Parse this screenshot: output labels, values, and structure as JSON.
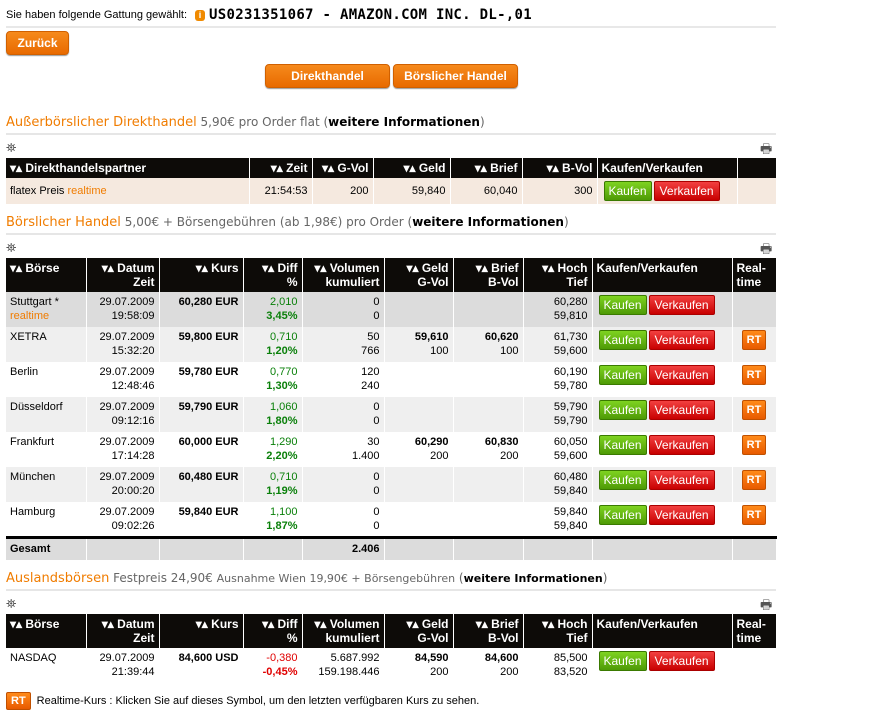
{
  "header": {
    "label": "Sie haben folgende Gattung gewählt:",
    "instrument": "US0231351067 - AMAZON.COM INC. DL-,01"
  },
  "buttons": {
    "back": "Zurück",
    "direct": "Direkthandel",
    "exchange": "Börslicher Handel",
    "buy": "Kaufen",
    "sell": "Verkaufen",
    "rt": "RT"
  },
  "direct": {
    "title": "Außerbörslicher Direkthandel",
    "fee": "5,90€ pro Order flat",
    "more": "weitere Informationen",
    "columns": [
      "Direkthandelspartner",
      "Zeit",
      "G-Vol",
      "Geld",
      "Brief",
      "B-Vol",
      "Kaufen/Verkaufen",
      ""
    ],
    "row": {
      "partner": "flatex Preis",
      "realtime": "realtime",
      "time": "21:54:53",
      "gvol": "200",
      "bid": "59,840",
      "ask": "60,040",
      "bvol": "300"
    }
  },
  "exchange": {
    "title": "Börslicher Handel",
    "fee": "5,00€ + Börsengebühren (ab 1,98€) pro Order",
    "more": "weitere Informationen",
    "columns": [
      [
        "Börse",
        ""
      ],
      [
        "Datum",
        "Zeit"
      ],
      [
        "Kurs",
        ""
      ],
      [
        "Diff",
        "%"
      ],
      [
        "Volumen",
        "kumuliert"
      ],
      [
        "Geld",
        "G-Vol"
      ],
      [
        "Brief",
        "B-Vol"
      ],
      [
        "Hoch",
        "Tief"
      ],
      [
        "Kaufen/Verkaufen",
        ""
      ],
      [
        "Real-",
        "time"
      ]
    ],
    "rows": [
      {
        "name": "Stuttgart *",
        "sub": "realtime",
        "date": "29.07.2009",
        "time": "19:58:09",
        "price": "60,280 EUR",
        "diff": "2,010",
        "pct": "3,45%",
        "vol": "0",
        "volcum": "0",
        "bid": "",
        "gvol": "",
        "ask": "",
        "bvol": "",
        "high": "60,280",
        "low": "59,810",
        "rt": false,
        "bg": "#dcdcdc"
      },
      {
        "name": "XETRA",
        "date": "29.07.2009",
        "time": "15:32:20",
        "price": "59,800 EUR",
        "diff": "0,710",
        "pct": "1,20%",
        "vol": "50",
        "volcum": "766",
        "bid": "59,610",
        "gvol": "100",
        "ask": "60,620",
        "bvol": "100",
        "high": "61,730",
        "low": "59,600",
        "rt": true,
        "bg": "#efefef"
      },
      {
        "name": "Berlin",
        "date": "29.07.2009",
        "time": "12:48:46",
        "price": "59,780 EUR",
        "diff": "0,770",
        "pct": "1,30%",
        "vol": "120",
        "volcum": "240",
        "bid": "",
        "gvol": "",
        "ask": "",
        "bvol": "",
        "high": "60,190",
        "low": "59,780",
        "rt": true,
        "bg": "#ffffff"
      },
      {
        "name": "Düsseldorf",
        "date": "29.07.2009",
        "time": "09:12:16",
        "price": "59,790 EUR",
        "diff": "1,060",
        "pct": "1,80%",
        "vol": "0",
        "volcum": "0",
        "bid": "",
        "gvol": "",
        "ask": "",
        "bvol": "",
        "high": "59,790",
        "low": "59,790",
        "rt": true,
        "bg": "#efefef"
      },
      {
        "name": "Frankfurt",
        "date": "29.07.2009",
        "time": "17:14:28",
        "price": "60,000 EUR",
        "diff": "1,290",
        "pct": "2,20%",
        "vol": "30",
        "volcum": "1.400",
        "bid": "60,290",
        "gvol": "200",
        "ask": "60,830",
        "bvol": "200",
        "high": "60,050",
        "low": "59,600",
        "rt": true,
        "bg": "#ffffff"
      },
      {
        "name": "München",
        "date": "29.07.2009",
        "time": "20:00:20",
        "price": "60,480 EUR",
        "diff": "0,710",
        "pct": "1,19%",
        "vol": "0",
        "volcum": "0",
        "bid": "",
        "gvol": "",
        "ask": "",
        "bvol": "",
        "high": "60,480",
        "low": "59,840",
        "rt": true,
        "bg": "#efefef"
      },
      {
        "name": "Hamburg",
        "date": "29.07.2009",
        "time": "09:02:26",
        "price": "59,840 EUR",
        "diff": "1,100",
        "pct": "1,87%",
        "vol": "0",
        "volcum": "0",
        "bid": "",
        "gvol": "",
        "ask": "",
        "bvol": "",
        "high": "59,840",
        "low": "59,840",
        "rt": true,
        "bg": "#ffffff"
      }
    ],
    "total": {
      "label": "Gesamt",
      "value": "2.406"
    }
  },
  "foreign": {
    "title": "Auslandsbörsen",
    "fee": "Festpreis 24,90€",
    "note": "Ausnahme Wien 19,90€ + Börsengebühren",
    "more": "weitere Informationen",
    "rows": [
      {
        "name": "NASDAQ",
        "date": "29.07.2009",
        "time": "21:39:44",
        "price": "84,600 USD",
        "diff": "-0,380",
        "pct": "-0,45%",
        "vol": "5.687.992",
        "volcum": "159.198.446",
        "bid": "84,590",
        "gvol": "200",
        "ask": "84,600",
        "bvol": "200",
        "high": "85,500",
        "low": "83,520",
        "rt": false,
        "bg": "#ffffff",
        "neg": true
      }
    ]
  },
  "footer": {
    "text": "Realtime-Kurs : Klicken Sie auf dieses Symbol, um den letzten verfügbaren Kurs zu sehen."
  },
  "colors": {
    "accent": "#f07c00",
    "header_bg": "#0d0b08",
    "buy": "#5cb514",
    "sell": "#e02020"
  }
}
